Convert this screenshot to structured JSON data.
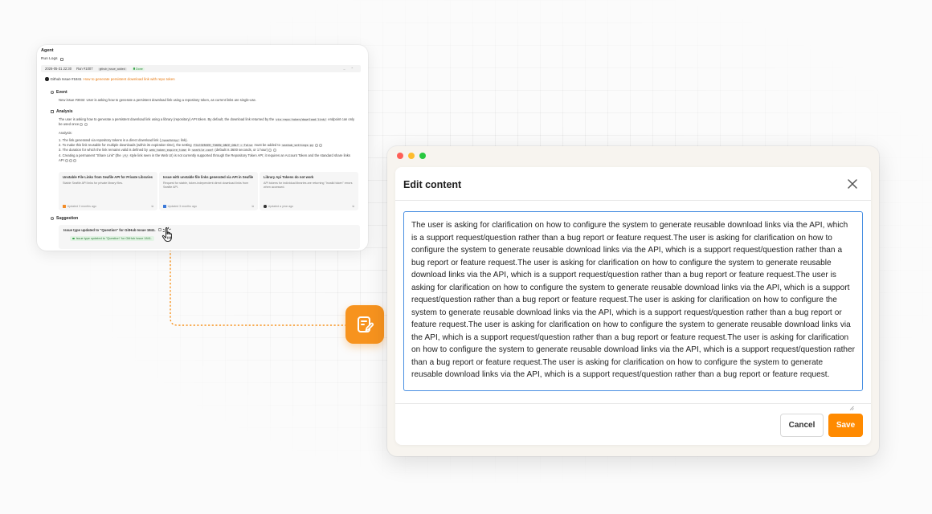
{
  "agent": {
    "title": "Agent",
    "run_logs": "Run Logs",
    "run": {
      "datetime": "2026-05-31 22:30",
      "run_id": "Run #1007",
      "tag": "github_issue_added",
      "status": "Done"
    },
    "issue_prefix": "Github Issue #1841",
    "issue_title": "How to generate persistent download link with repo token",
    "event_heading": "Event",
    "event_text": "New issue #3032: User is asking how to generate a persistent download link using a repository token, as current links are single-use.",
    "analysis_heading": "Analysis",
    "analysis_text_a": "The user is asking how to generate a persistent download link using a library (repository) API token. By default, the download link returned by the",
    "analysis_code": "via-repo-token/download-link/",
    "analysis_text_b": "endpoint can only be used once",
    "analysis_label": "Analysis:",
    "steps": [
      {
        "a": "1. The link generated via repository tokens is a direct download link (",
        "code": "/seafhttp/",
        "b": " link)."
      },
      {
        "a": "2. To make this link reusable for multiple downloads (within its expiration time), the setting ",
        "code": "FILESERVER_TOKEN_ONCE_ONLY = False",
        "b": " must be added to ",
        "code2": "seahub_settings.py"
      },
      {
        "a": "3. The duration for which the link remains valid is defined by ",
        "code": "web_token_expire_time",
        "b": " in ",
        "code2": "seafile.conf",
        "c": " (default is 3600 seconds, or 1 hour)"
      },
      {
        "a": "4. Creating a permanent \"Share Link\" (the ",
        "code": "/f/",
        "b": " style link seen in the Web UI) is not currently supported through the Repository Token API; it requires an Account Token and the standard share links API"
      }
    ],
    "cards": [
      {
        "title": "Unstable File Links from Seafile API for Private Libraries",
        "desc": "Stable Seafile API links for private library files.",
        "updated": "Updated 3 months ago"
      },
      {
        "title": "Issue with unstable file links generated via API in Seafile",
        "desc": "Request for stable, token-independent direct download links from Seafile API.",
        "updated": "Updated 3 months ago"
      },
      {
        "title": "Library Api Tokens do not work",
        "desc": "API tokens for individual libraries are returning \"Invalid token\" errors when accessed.",
        "updated": "Updated a year ago"
      }
    ],
    "suggestion_heading": "Suggestion",
    "suggestion_title": "Issue type updated to \"Question\" for GitHub Issue 1841.",
    "suggestion_pill": "Issue type updated to \"Question\" for GitHub Issue 1841."
  },
  "dialog": {
    "title": "Edit content",
    "content": "The user is asking for clarification on how to configure the system to generate reusable download links via the API, which is a support request/question rather than a bug report or feature request.The user is asking for clarification on how to configure the system to generate reusable download links via the API, which is a support request/question rather than a bug report or feature request.The user is asking for clarification on how to configure the system to generate reusable download links via the API, which is a support request/question rather than a bug report or feature request.The user is asking for clarification on how to configure the system to generate reusable download links via the API, which is a support request/question rather than a bug report or feature request.The user is asking for clarification on how to configure the system to generate reusable download links via the API, which is a support request/question rather than a bug report or feature request.The user is asking for clarification on how to configure the system to generate reusable download links via the API, which is a support request/question rather than a bug report or feature request.The user is asking for clarification on how to configure the system to generate reusable download links via the API, which is a support request/question rather than a bug report or feature request.The user is asking for clarification on how to configure the system to generate reusable download links via the API, which is a support request/question rather than a bug report or feature request.",
    "cancel_label": "Cancel",
    "save_label": "Save"
  },
  "colors": {
    "accent": "#ff8a00",
    "focus_border": "#4a90e2",
    "done": "#3aa24c"
  },
  "icons": {
    "tool": "edit-note-icon",
    "cursor": "hand-pointer-icon",
    "close": "close-icon"
  }
}
